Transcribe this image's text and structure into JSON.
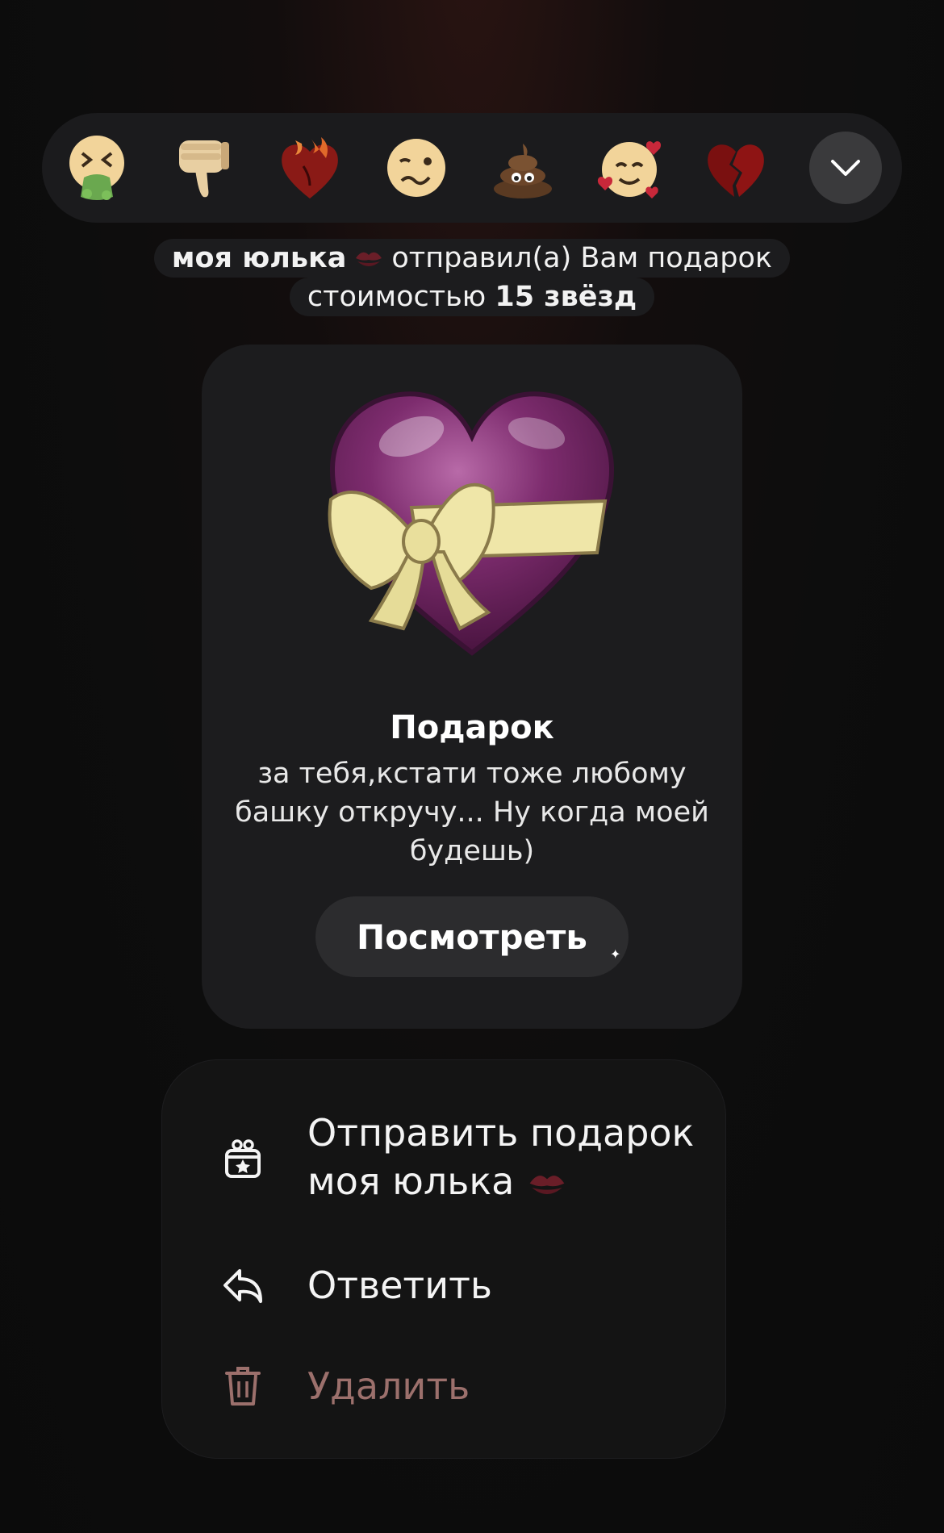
{
  "reactions": [
    {
      "icon": "vomiting-face-icon"
    },
    {
      "icon": "thumbs-down-icon"
    },
    {
      "icon": "heart-on-fire-icon"
    },
    {
      "icon": "woozy-face-icon"
    },
    {
      "icon": "pile-of-poo-icon"
    },
    {
      "icon": "smiling-face-with-hearts-icon"
    },
    {
      "icon": "broken-heart-icon"
    }
  ],
  "more_reactions_icon": "chevron-down-icon",
  "service_message": {
    "sender": "моя юлька",
    "sender_emoji": "kiss-mark-icon",
    "action": "отправил(а) Вам подарок",
    "cost_prefix": "стоимостью",
    "cost_value": "15 звёзд"
  },
  "gift": {
    "title": "Подарок",
    "message": "за тебя,кстати тоже любому башку откручу... Ну когда моей будешь)",
    "view_button": "Посмотреть",
    "sticker_icon": "heart-with-ribbon-icon"
  },
  "menu": {
    "send_gift_line1": "Отправить подарок",
    "send_gift_line2": "моя юлька",
    "reply": "Ответить",
    "delete": "Удалить"
  },
  "colors": {
    "background": "#0d0d0d",
    "panel": "#1c1c1e",
    "danger": "#9c706c",
    "heart": "#7a2a6a",
    "ribbon": "#efe6a8"
  }
}
